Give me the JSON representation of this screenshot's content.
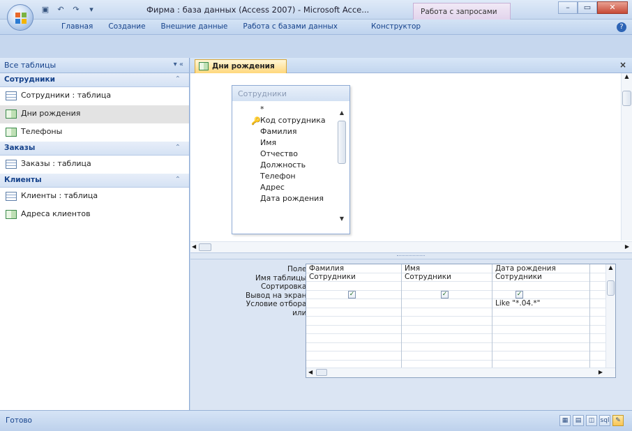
{
  "window": {
    "title": "Фирма : база данных (Access 2007) - Microsoft Acce...",
    "context_tab_title": "Работа с запросами",
    "buttons": {
      "minimize": "–",
      "maximize": "▭",
      "close": "✕"
    }
  },
  "ribbon": {
    "tabs": [
      "Главная",
      "Создание",
      "Внешние данные",
      "Работа с базами данных"
    ],
    "context_tab": "Конструктор"
  },
  "nav": {
    "header": "Все таблицы",
    "header_controls": "▾ «",
    "groups": [
      {
        "name": "Сотрудники",
        "items": [
          {
            "label": "Сотрудники : таблица",
            "icon": "table-icon"
          },
          {
            "label": "Дни рождения",
            "icon": "query-icon",
            "selected": true
          },
          {
            "label": "Телефоны",
            "icon": "query-icon"
          }
        ]
      },
      {
        "name": "Заказы",
        "items": [
          {
            "label": "Заказы : таблица",
            "icon": "table-icon"
          }
        ]
      },
      {
        "name": "Клиенты",
        "items": [
          {
            "label": "Клиенты : таблица",
            "icon": "table-icon"
          },
          {
            "label": "Адреса клиентов",
            "icon": "query-icon"
          }
        ]
      }
    ]
  },
  "document": {
    "tab_label": "Дни рождения",
    "close": "×",
    "table_box": {
      "title": "Сотрудники",
      "fields": [
        "*",
        "Код сотрудника",
        "Фамилия",
        "Имя",
        "Отчество",
        "Должность",
        "Телефон",
        "Адрес",
        "Дата рождения"
      ],
      "key_field_index": 1
    },
    "grid": {
      "row_labels": [
        "Поле:",
        "Имя таблицы:",
        "Сортировка:",
        "Вывод на экран:",
        "Условие отбора:",
        "или:"
      ],
      "columns": [
        {
          "field": "Фамилия",
          "table": "Сотрудники",
          "sort": "",
          "show": true,
          "criteria": ""
        },
        {
          "field": "Имя",
          "table": "Сотрудники",
          "sort": "",
          "show": true,
          "criteria": ""
        },
        {
          "field": "Дата рождения",
          "table": "Сотрудники",
          "sort": "",
          "show": true,
          "criteria": "Like \"*.04.*\""
        }
      ]
    }
  },
  "status": {
    "text": "Готово",
    "view_icons": [
      "datasheet-view-icon",
      "pivot-table-icon",
      "pivot-chart-icon",
      "sql-view-icon",
      "design-view-icon"
    ]
  }
}
